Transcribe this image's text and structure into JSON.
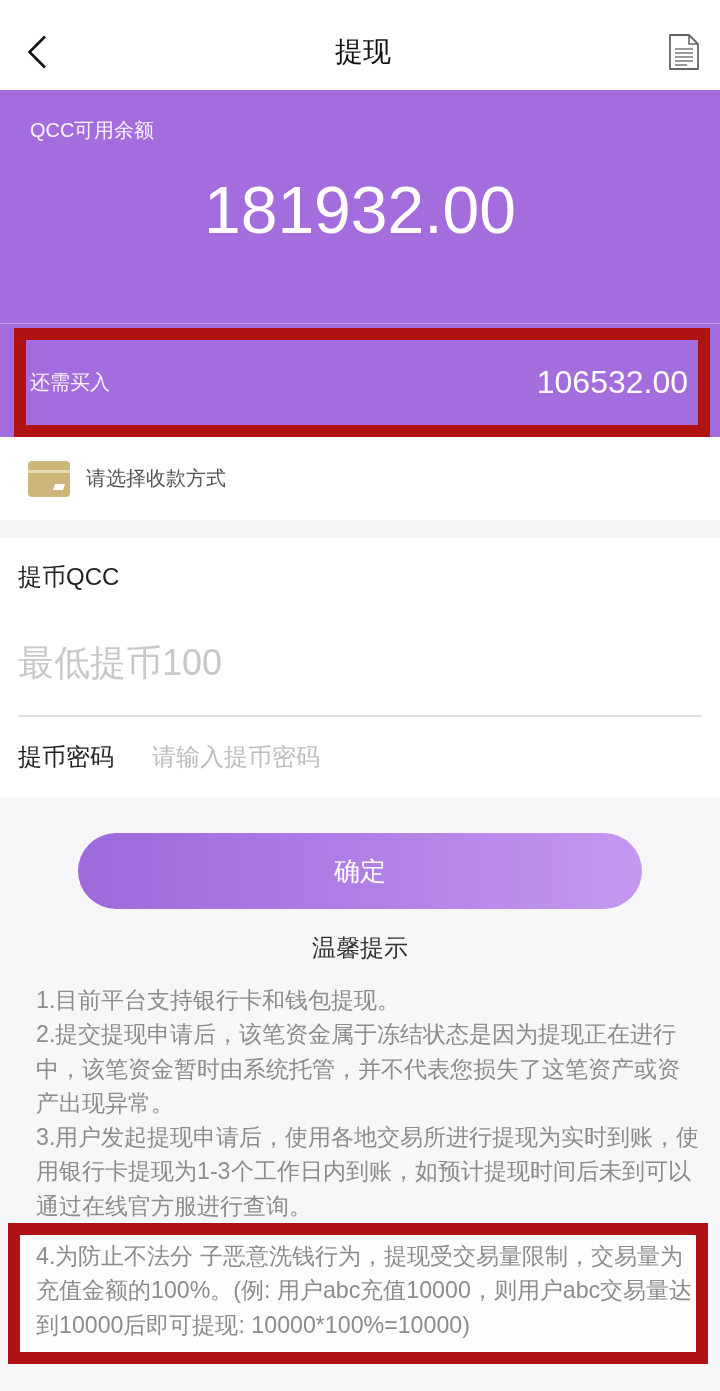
{
  "header": {
    "title": "提现"
  },
  "balance": {
    "label": "QCC可用余额",
    "amount": "181932.00"
  },
  "required_purchase": {
    "label": "还需买入",
    "amount": "106532.00",
    "highlighted": true
  },
  "payment_method": {
    "text": "请选择收款方式"
  },
  "amount_field": {
    "label": "提币QCC",
    "placeholder": "最低提币100"
  },
  "password_field": {
    "label": "提币密码",
    "placeholder": "请输入提币密码"
  },
  "submit_button": {
    "label": "确定"
  },
  "notice": {
    "title": "温馨提示",
    "items": [
      {
        "text": "1.目前平台支持银行卡和钱包提现。",
        "highlighted": false
      },
      {
        "text": "2.提交提现申请后，该笔资金属于冻结状态是因为提现正在进行中，该笔资金暂时由系统托管，并不代表您损失了这笔资产或资产出现异常。",
        "highlighted": false
      },
      {
        "text": "3.用户发起提现申请后，使用各地交易所进行提现为实时到账，使用银行卡提现为1-3个工作日内到账，如预计提现时间后未到可以通过在线官方服进行查询。",
        "highlighted": false
      },
      {
        "text": "4.为防止不法分 子恶意洗钱行为，提现受交易量限制，交易量为充值金额的100%。(例: 用户abc充值10000，则用户abc交易量达到10000后即可提现: 10000*100%=10000)",
        "highlighted": true
      }
    ]
  }
}
